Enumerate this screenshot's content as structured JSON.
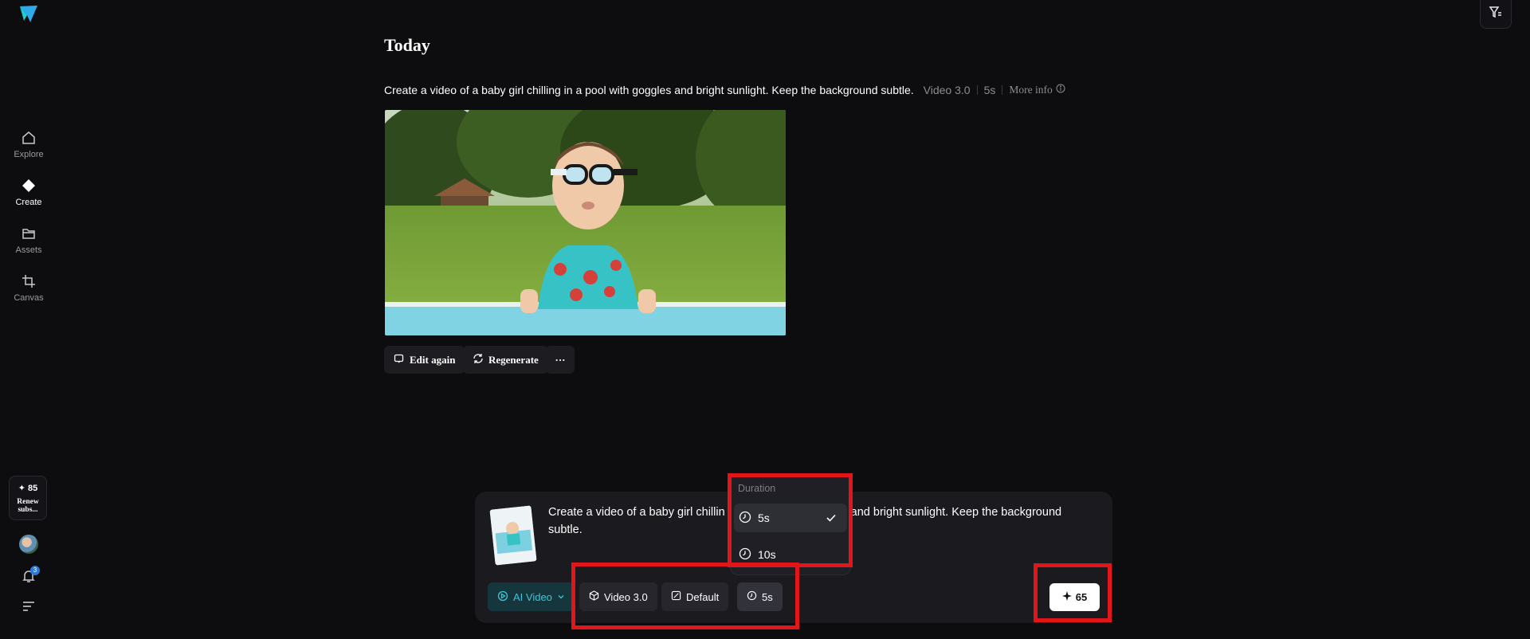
{
  "sidebar": {
    "items": [
      {
        "label": "Explore",
        "icon": "home-icon"
      },
      {
        "label": "Create",
        "icon": "diamond-icon",
        "active": true
      },
      {
        "label": "Assets",
        "icon": "folder-icon"
      },
      {
        "label": "Canvas",
        "icon": "crop-icon"
      }
    ],
    "credits": "✦ 85",
    "renew": "Renew subs...",
    "notification_count": "3"
  },
  "main": {
    "section_title": "Today",
    "prompt": "Create a video of a baby girl chilling in a pool with goggles and bright sunlight. Keep the background subtle.",
    "model": "Video 3.0",
    "duration": "5s",
    "more_info": "More info",
    "actions": {
      "edit_again": "Edit again",
      "regenerate": "Regenerate",
      "more": "···"
    }
  },
  "composer": {
    "text": "Create a video of a baby girl chillin",
    "text_tail": "and bright sunlight. Keep the background",
    "text_line2": "subtle.",
    "mode": "AI Video",
    "model": "Video 3.0",
    "style": "Default",
    "duration": "5s",
    "send_cost": "65"
  },
  "dropdown": {
    "title": "Duration",
    "options": [
      {
        "label": "5s",
        "selected": true
      },
      {
        "label": "10s",
        "selected": false
      }
    ]
  },
  "colors": {
    "background": "#0d0d0f",
    "accent": "#3cc7d6",
    "highlight": "#e0161b"
  }
}
